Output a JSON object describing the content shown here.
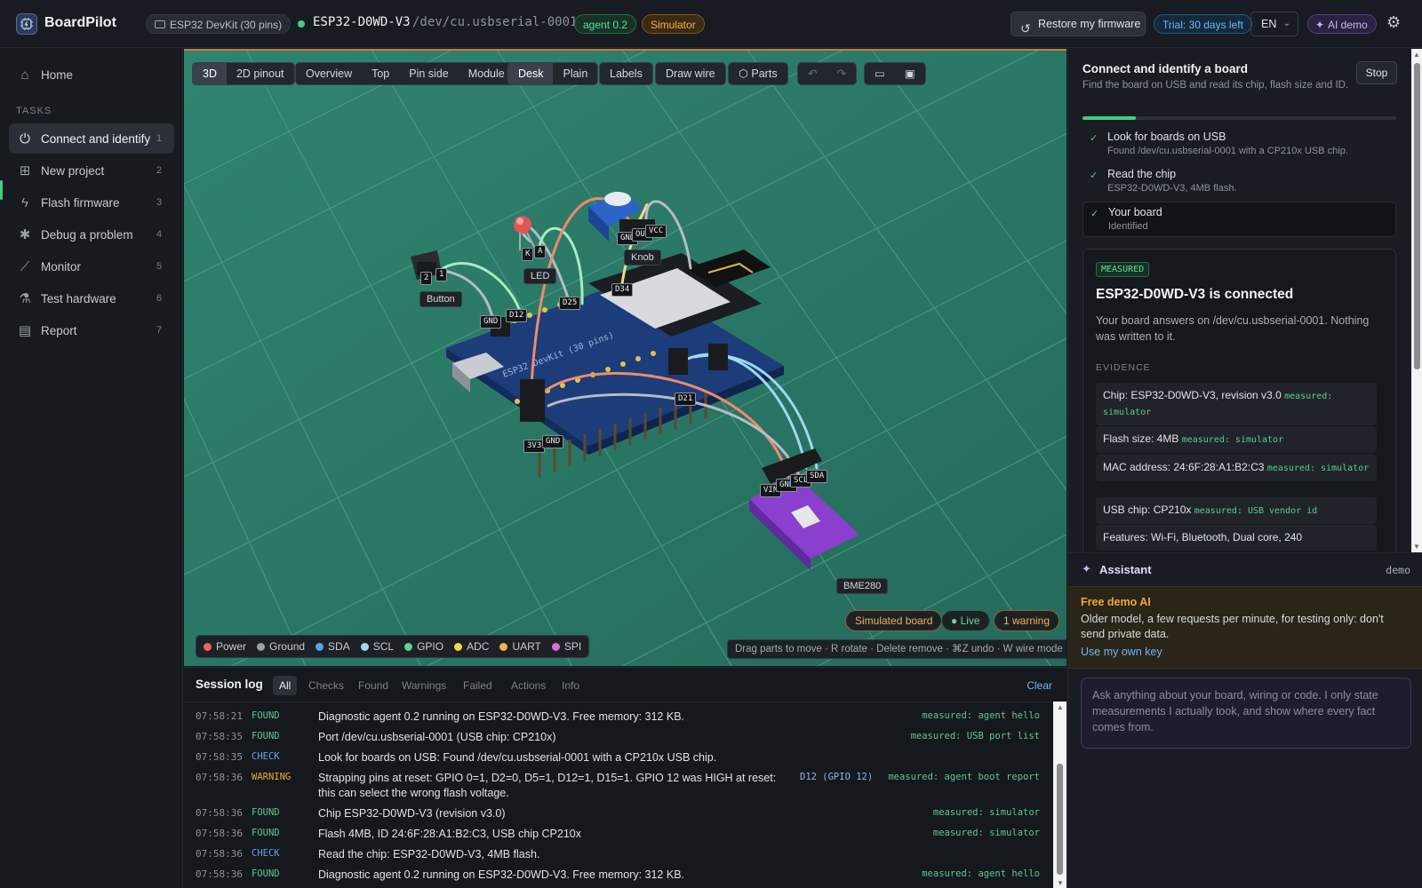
{
  "topbar": {
    "brand": "BoardPilot",
    "board_pill": "ESP32 DevKit (30 pins)",
    "chip": "ESP32-D0WD-V3",
    "port": "/dev/cu.usbserial-0001",
    "agent_badge": "agent 0.2",
    "simulator_badge": "Simulator",
    "restore_button": "Restore my firmware",
    "trial_badge": "Trial: 30 days left",
    "language": "EN",
    "ai_demo_badge": "AI demo",
    "icons": {
      "logo": "chip-logo-icon",
      "restore": "restore-icon",
      "settings": "gear-icon",
      "ai": "sparkle-icon"
    },
    "colors": {
      "connected": "#3fcf86",
      "simulator": "#f3b24a",
      "trial": "#6db8f2",
      "ai": "#c9b6ff"
    }
  },
  "sidebar": {
    "home_label": "Home",
    "tasks_heading": "TASKS",
    "tasks": [
      {
        "label": "Connect and identify",
        "num": "1",
        "icon": "plug-icon",
        "active": true
      },
      {
        "label": "New project",
        "num": "2",
        "icon": "grid-plus-icon"
      },
      {
        "label": "Flash firmware",
        "num": "3",
        "icon": "bolt-icon"
      },
      {
        "label": "Debug a problem",
        "num": "4",
        "icon": "bug-icon"
      },
      {
        "label": "Monitor",
        "num": "5",
        "icon": "chart-line-icon"
      },
      {
        "label": "Test hardware",
        "num": "6",
        "icon": "flask-icon"
      },
      {
        "label": "Report",
        "num": "7",
        "icon": "document-icon"
      }
    ]
  },
  "viewport": {
    "toolbar": {
      "view_mode": [
        "3D",
        "2D pinout"
      ],
      "camera": [
        "Overview",
        "Top",
        "Pin side",
        "Module"
      ],
      "surface": [
        "Desk",
        "Plain"
      ],
      "labels": "Labels",
      "draw_wire": "Draw wire",
      "parts": "Parts",
      "selected": {
        "view_mode": "3D",
        "surface": "Desk"
      }
    },
    "part_labels": {
      "button": "Button",
      "led": "LED",
      "knob": "Knob",
      "sensor": "BME280"
    },
    "pin_tags": {
      "board": [
        "GND",
        "D12",
        "D25",
        "D34",
        "D21",
        "3V3",
        "GND"
      ],
      "button": [
        "2",
        "1"
      ],
      "led": [
        "K",
        "A"
      ],
      "knob": [
        "GND",
        "OUT",
        "VCC"
      ],
      "sensor": [
        "VIN",
        "GND",
        "SCL",
        "SDA"
      ]
    },
    "board_silkscreen": "ESP32 DevKit (30 pins)",
    "legend": [
      {
        "label": "Power",
        "color": "#f0655b"
      },
      {
        "label": "Ground",
        "color": "#9aa0aa"
      },
      {
        "label": "SDA",
        "color": "#4aa8f0"
      },
      {
        "label": "SCL",
        "color": "#9fd8f2"
      },
      {
        "label": "GPIO",
        "color": "#5fd08f"
      },
      {
        "label": "ADC",
        "color": "#f3d44a"
      },
      {
        "label": "UART",
        "color": "#f3b24a"
      },
      {
        "label": "SPI",
        "color": "#e06ad8"
      }
    ],
    "status": {
      "simulated": "Simulated board",
      "live": "● Live",
      "warning": "1 warning"
    },
    "hint": "Drag parts to move · R rotate · Delete remove · ⌘Z undo · W wire mode"
  },
  "log": {
    "title": "Session log",
    "tabs": [
      "All",
      "Checks",
      "Found",
      "Warnings",
      "Failed",
      "Actions",
      "Info"
    ],
    "active_tab": "All",
    "clear": "Clear",
    "rows": [
      {
        "time": "07:58:21",
        "kind": "FOUND",
        "msg": "Diagnostic agent 0.2 running on ESP32-D0WD-V3. Free memory: 312 KB.",
        "src": "measured: agent hello"
      },
      {
        "time": "07:58:35",
        "kind": "FOUND",
        "msg": "Port /dev/cu.usbserial-0001 (USB chip: CP210x)",
        "src": "measured: USB port list"
      },
      {
        "time": "07:58:35",
        "kind": "CHECK",
        "msg": "Look for boards on USB: Found /dev/cu.usbserial-0001 with a CP210x USB chip.",
        "src": ""
      },
      {
        "time": "07:58:36",
        "kind": "WARNING",
        "msg": "Strapping pins at reset: GPIO 0=1, D2=0, D5=1, D12=1, D15=1. GPIO 12 was HIGH at reset: this can select the wrong flash voltage.",
        "pin": "D12 (GPIO 12)",
        "src": "measured: agent boot report"
      },
      {
        "time": "07:58:36",
        "kind": "FOUND",
        "msg": "Chip ESP32-D0WD-V3 (revision v3.0)",
        "src": "measured: simulator"
      },
      {
        "time": "07:58:36",
        "kind": "FOUND",
        "msg": "Flash 4MB, ID 24:6F:28:A1:B2:C3, USB chip CP210x",
        "src": "measured: simulator"
      },
      {
        "time": "07:58:36",
        "kind": "CHECK",
        "msg": "Read the chip: ESP32-D0WD-V3, 4MB flash.",
        "src": ""
      },
      {
        "time": "07:58:36",
        "kind": "FOUND",
        "msg": "Diagnostic agent 0.2 running on ESP32-D0WD-V3. Free memory: 312 KB.",
        "src": "measured: agent hello"
      }
    ]
  },
  "task_panel": {
    "title": "Connect and identify a board",
    "subtitle": "Find the board on USB and read its chip, flash size and ID.",
    "stop_button": "Stop",
    "progress": 0.17,
    "steps": [
      {
        "title": "Look for boards on USB",
        "detail": "Found /dev/cu.usbserial-0001 with a CP210x USB chip."
      },
      {
        "title": "Read the chip",
        "detail": "ESP32-D0WD-V3, 4MB flash."
      },
      {
        "title": "Your board",
        "detail": "Identified"
      }
    ],
    "result": {
      "badge": "MEASURED",
      "title": "ESP32-D0WD-V3 is connected",
      "body": "Your board answers on /dev/cu.usbserial-0001. Nothing was written to it.",
      "evidence_heading": "EVIDENCE",
      "evidence": [
        {
          "text": "Chip: ESP32-D0WD-V3, revision v3.0",
          "source": "measured: simulator"
        },
        {
          "text": "Flash size: 4MB",
          "source": "measured: simulator"
        },
        {
          "text": "MAC address: 24:6F:28:A1:B2:C3",
          "source": "measured: simulator"
        },
        {
          "text": "USB chip: CP210x",
          "source": "measured: USB vendor id"
        },
        {
          "text": "Features: Wi-Fi, Bluetooth, Dual core, 240",
          "source": ""
        }
      ]
    }
  },
  "assistant": {
    "title": "Assistant",
    "mode": "demo",
    "demo_title": "Free demo AI",
    "demo_text": "Older model, a few requests per minute, for testing only: don't send private data.",
    "demo_link": "Use my own key",
    "placeholder": "Ask anything about your board, wiring or code. I only state measurements I actually took, and show where every fact comes from."
  }
}
